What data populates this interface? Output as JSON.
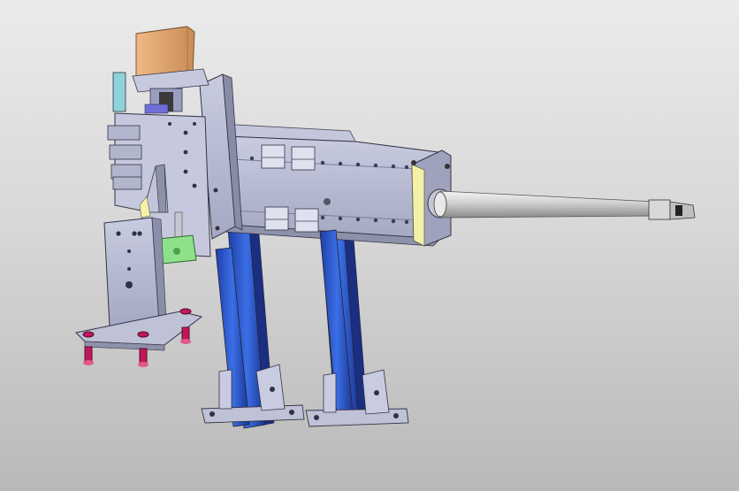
{
  "scene": {
    "description_visible_text": "",
    "colors": {
      "background_top": "#ebebeb",
      "background_bottom": "#b9b9b9",
      "steel": "#b8bcd2",
      "steel_dark": "#8e92aa",
      "blue_rail": "#2c55c8",
      "motor": "#e0a470",
      "green_block": "#8fe08a",
      "yellow_plate": "#f4f0a8",
      "cyan_plate": "#8fd2dc",
      "magenta_suction": "#c0185a",
      "rod": "#d8d8d8"
    }
  }
}
